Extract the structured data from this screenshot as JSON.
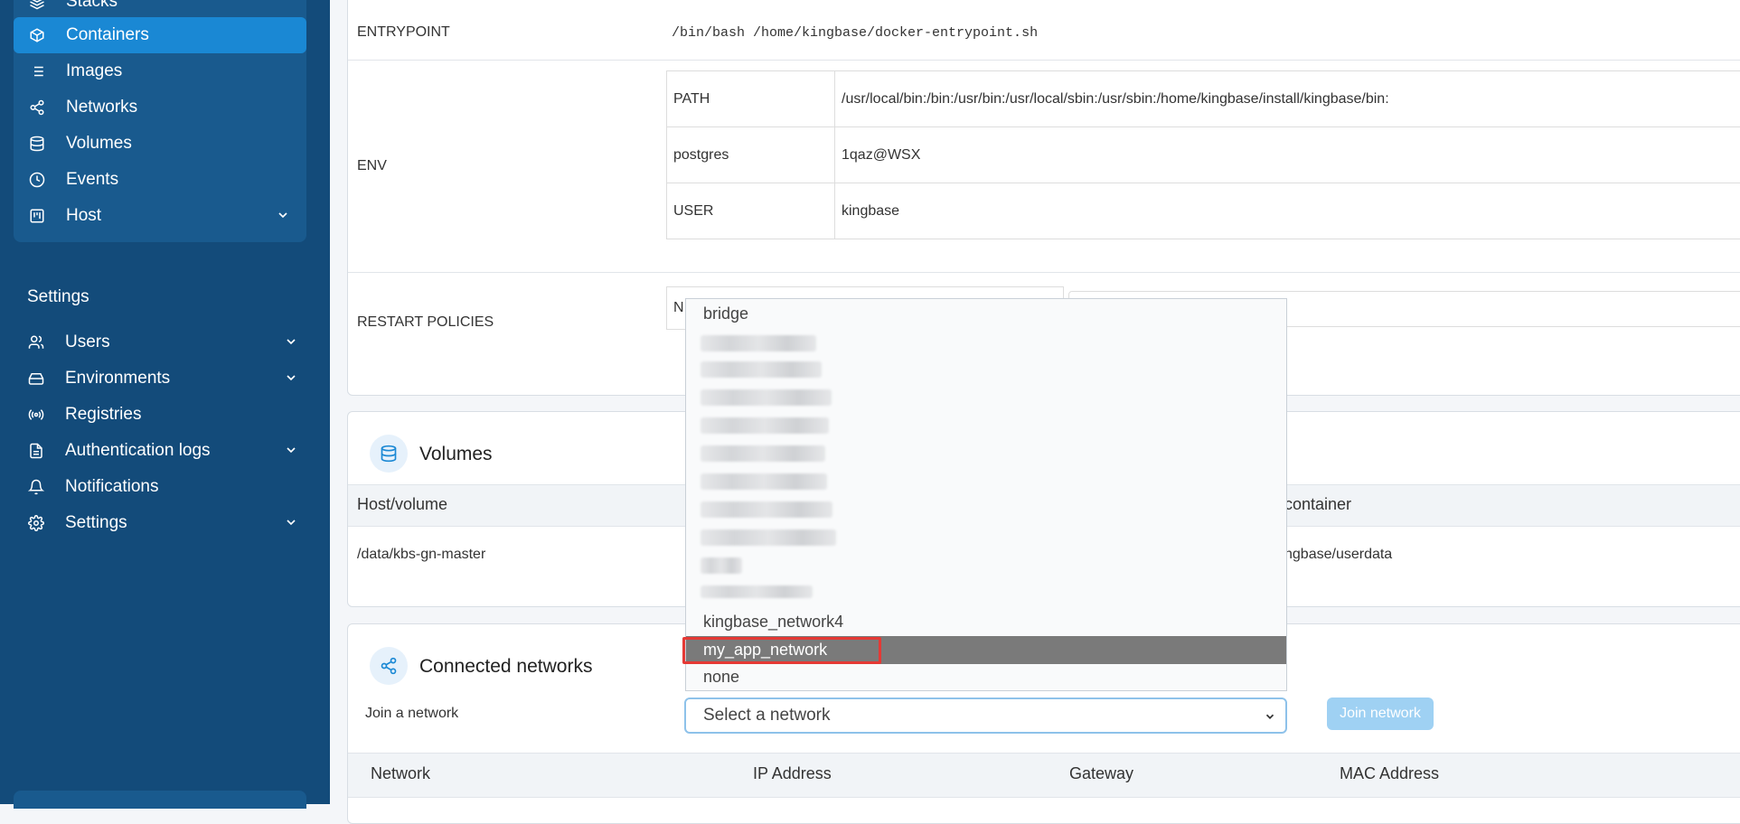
{
  "sidebar": {
    "items": [
      {
        "label": "Stacks",
        "icon": "layers-icon"
      },
      {
        "label": "Containers",
        "icon": "cube-icon",
        "active": true
      },
      {
        "label": "Images",
        "icon": "list-icon"
      },
      {
        "label": "Networks",
        "icon": "share-icon"
      },
      {
        "label": "Volumes",
        "icon": "database-icon"
      },
      {
        "label": "Events",
        "icon": "clock-icon"
      },
      {
        "label": "Host",
        "icon": "board-icon"
      }
    ],
    "settings_title": "Settings",
    "settings_items": [
      {
        "label": "Users",
        "icon": "users-icon"
      },
      {
        "label": "Environments",
        "icon": "hard-drive-icon"
      },
      {
        "label": "Registries",
        "icon": "radio-icon"
      },
      {
        "label": "Authentication logs",
        "icon": "file-text-icon"
      },
      {
        "label": "Notifications",
        "icon": "bell-icon"
      },
      {
        "label": "Settings",
        "icon": "gear-icon"
      }
    ]
  },
  "details": {
    "entrypoint_label": "ENTRYPOINT",
    "entrypoint_value": "/bin/bash /home/kingbase/docker-entrypoint.sh",
    "env_label": "ENV",
    "env": [
      {
        "key": "PATH",
        "value": "/usr/local/bin:/bin:/usr/bin:/usr/local/sbin:/usr/sbin:/home/kingbase/install/kingbase/bin:"
      },
      {
        "key": "postgres",
        "value": "1qaz@WSX"
      },
      {
        "key": "USER",
        "value": "kingbase"
      }
    ],
    "restart_label": "RESTART POLICIES",
    "restart_cell_partial": "N"
  },
  "volumes": {
    "title": "Volumes",
    "col_host": "Host/volume",
    "col_container_partial": "container",
    "row_host": "/data/kbs-gn-master",
    "row_container_partial": "ngbase/userdata"
  },
  "networks": {
    "title": "Connected networks",
    "join_label": "Join a network",
    "select_placeholder": "Select a network",
    "join_button": "Join network",
    "columns": [
      "Network",
      "IP Address",
      "Gateway",
      "MAC Address"
    ]
  },
  "dropdown": {
    "first": "bridge",
    "network4": "kingbase_network4",
    "selected": "my_app_network",
    "last": "none"
  },
  "colors": {
    "sidebar": "#134b7a",
    "active": "#1a88d4",
    "highlight": "#e53935"
  }
}
